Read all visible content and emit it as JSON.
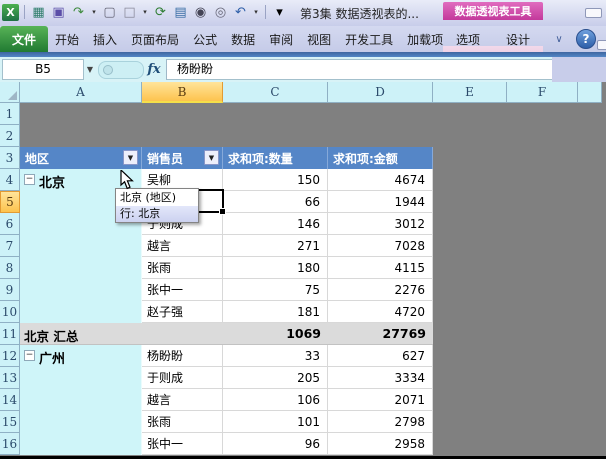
{
  "window": {
    "title": "第3集 数据透视表的...",
    "contextual_tool_label": "数据透视表工具"
  },
  "qat": {
    "icons": [
      {
        "name": "excel-logo",
        "glyph": "X"
      },
      {
        "name": "separator",
        "glyph": ""
      },
      {
        "name": "form-grid-icon",
        "glyph": "▦",
        "color": "#2e7d6b"
      },
      {
        "name": "save-icon",
        "glyph": "▣",
        "color": "#5b4ea8"
      },
      {
        "name": "redo-icon",
        "glyph": "↷",
        "color": "#3d8a3d"
      },
      {
        "name": "dropdown-arrow-icon",
        "glyph": "▾"
      },
      {
        "name": "new-document-icon",
        "glyph": "▢",
        "color": "#667"
      },
      {
        "name": "shape-fill-icon",
        "glyph": "□",
        "color": "#889"
      },
      {
        "name": "dropdown-arrow-icon",
        "glyph": "▾"
      },
      {
        "name": "refresh-all-icon",
        "glyph": "⟳",
        "color": "#2e7d32"
      },
      {
        "name": "table-icon",
        "glyph": "▤",
        "color": "#3a6ea5"
      },
      {
        "name": "find-icon",
        "glyph": "◉",
        "color": "#445"
      },
      {
        "name": "print-preview-icon",
        "glyph": "◎",
        "color": "#667"
      },
      {
        "name": "undo-icon",
        "glyph": "↶",
        "color": "#2d5ea8"
      },
      {
        "name": "dropdown-arrow-icon",
        "glyph": "▾"
      },
      {
        "name": "separator",
        "glyph": ""
      },
      {
        "name": "qat-overflow-icon",
        "glyph": "▾"
      }
    ]
  },
  "ribbon": {
    "tabs": [
      {
        "label": "文件"
      },
      {
        "label": "开始"
      },
      {
        "label": "插入"
      },
      {
        "label": "页面布局"
      },
      {
        "label": "公式"
      },
      {
        "label": "数据"
      },
      {
        "label": "审阅"
      },
      {
        "label": "视图"
      },
      {
        "label": "开发工具"
      },
      {
        "label": "加载项"
      }
    ],
    "contextual_tabs": [
      {
        "label": "选项"
      },
      {
        "label": "设计"
      }
    ],
    "minimize_ribbon_glyph": "∨",
    "help_glyph": "?"
  },
  "formula_bar": {
    "name_box_value": "B5",
    "function_label": "fx",
    "content": "杨盼盼"
  },
  "grid": {
    "column_headers": [
      "A",
      "B",
      "C",
      "D",
      "E",
      "F",
      ""
    ],
    "row_headers": [
      "1",
      "2",
      "3",
      "4",
      "5",
      "6",
      "7",
      "8",
      "9",
      "10",
      "11",
      "12",
      "13",
      "14",
      "15",
      "16"
    ],
    "selected_cell": "B5",
    "selected_column": "B",
    "selected_row": "5"
  },
  "pivot": {
    "column_headers": [
      "地区",
      "销售员",
      "求和项:数量",
      "求和项:金额"
    ],
    "collapse_glyph": "−",
    "filter_glyph": "▼",
    "groups": [
      {
        "region": "北京",
        "rows": [
          {
            "name": "吴柳",
            "qty": "150",
            "amount": "4674"
          },
          {
            "name": "杨盼盼",
            "qty": "66",
            "amount": "1944"
          },
          {
            "name": "于则成",
            "qty": "146",
            "amount": "3012"
          },
          {
            "name": "越言",
            "qty": "271",
            "amount": "7028"
          },
          {
            "name": "张雨",
            "qty": "180",
            "amount": "4115"
          },
          {
            "name": "张中一",
            "qty": "75",
            "amount": "2276"
          },
          {
            "name": "赵子强",
            "qty": "181",
            "amount": "4720"
          }
        ],
        "subtotal": {
          "label": "北京 汇总",
          "qty": "1069",
          "amount": "27769"
        }
      },
      {
        "region": "广州",
        "rows": [
          {
            "name": "杨盼盼",
            "qty": "33",
            "amount": "627"
          },
          {
            "name": "于则成",
            "qty": "205",
            "amount": "3334"
          },
          {
            "name": "越言",
            "qty": "106",
            "amount": "2071"
          },
          {
            "name": "张雨",
            "qty": "101",
            "amount": "2798"
          },
          {
            "name": "张中一",
            "qty": "96",
            "amount": "2958"
          }
        ]
      }
    ]
  },
  "tooltip": {
    "line1": "北京 (地区)",
    "line2": "行: 北京"
  },
  "colors": {
    "pivot_header_blue": "#5586c7",
    "header_cyan": "#cdf2f8",
    "selected_header_orange": "#fdc34e",
    "outside_gray": "#808080",
    "subtotal_gray": "#dbdbdb",
    "group_column_cyan": "#cff5f9",
    "contextual_magenta": "#c3399b",
    "file_tab_green": "#217a32",
    "help_blue": "#2d5ea8",
    "titlebar_lavender": "#c8cdea"
  }
}
